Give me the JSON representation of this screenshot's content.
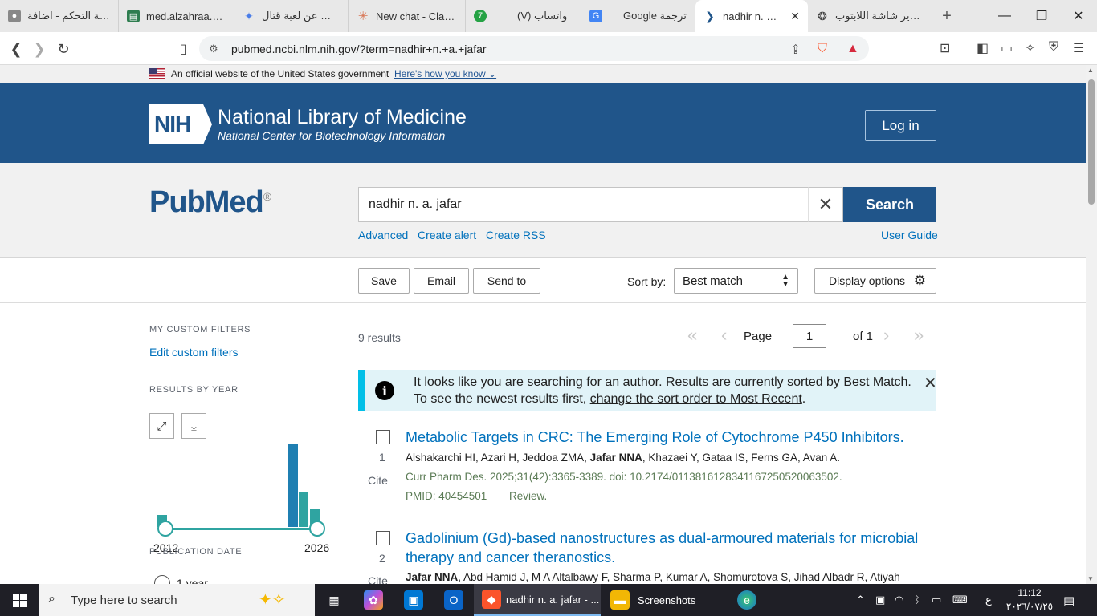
{
  "browser": {
    "tabs": [
      {
        "title": "لوحة التحكم - اضافة",
        "icon": "user-icon"
      },
      {
        "title": "med.alzahraa.edu",
        "icon": "document-icon"
      },
      {
        "title": "البحث عن لعبة قتال",
        "icon": "gemini-icon"
      },
      {
        "title": "New chat - Claude",
        "icon": "claude-icon"
      },
      {
        "title": "(V) واتساب",
        "icon": "whatsapp-icon",
        "badge": "7"
      },
      {
        "title": "Google ترجمة",
        "icon": "translate-icon"
      },
      {
        "title": "nadhir n. a. jafar",
        "icon": "pubmed-icon",
        "active": true
      },
      {
        "title": "تصوير شاشة اللابتوب",
        "icon": "chatgpt-icon"
      }
    ],
    "url": "pubmed.ncbi.nlm.nih.gov/?term=nadhir+n.+a.+jafar"
  },
  "gov_banner": {
    "text": "An official website of the United States government",
    "link": "Here's how you know"
  },
  "header": {
    "logo_text": "NIH",
    "title": "National Library of Medicine",
    "subtitle": "National Center for Biotechnology Information",
    "login": "Log in"
  },
  "search": {
    "logo": "PubMed",
    "logo_mark": "®",
    "query": "nadhir n. a. jafar",
    "button": "Search",
    "links": [
      "Advanced",
      "Create alert",
      "Create RSS"
    ],
    "user_guide": "User Guide"
  },
  "actions": {
    "save": "Save",
    "email": "Email",
    "send_to": "Send to",
    "sort_label": "Sort by:",
    "sort_value": "Best match",
    "display_options": "Display options"
  },
  "sidebar": {
    "custom_filters_heading": "MY CUSTOM FILTERS",
    "edit_custom_filters": "Edit custom filters",
    "results_by_year_heading": "RESULTS BY YEAR",
    "year_start": "2012",
    "year_end": "2026",
    "publication_date_heading": "PUBLICATION DATE",
    "first_option": "1 year"
  },
  "chart_data": {
    "type": "bar",
    "title": "RESULTS BY YEAR",
    "x_range": [
      2012,
      2026
    ],
    "values_relative": [
      {
        "year": 2012,
        "height": 0.14
      },
      {
        "year": 2024,
        "height": 1.0
      },
      {
        "year": 2025,
        "height": 0.41
      },
      {
        "year": 2026,
        "height": 0.21
      }
    ]
  },
  "results": {
    "count": "9 results",
    "page_label": "Page",
    "page": "1",
    "of": "of 1",
    "notice_line1": "It looks like you are searching for an author. Results are currently sorted by Best Match.",
    "notice_line2_prefix": "To see the newest results first,",
    "notice_link": "change the sort order to Most Recent",
    "notice_suffix": ".",
    "cite_label": "Cite",
    "items": [
      {
        "num": "1",
        "title": "Metabolic Targets in CRC: The Emerging Role of Cytochrome P450 Inhibitors.",
        "authors_before": "Alshakarchi HI, Azari H, Jeddoa ZMA,",
        "authors_bold": "Jafar NNA",
        "authors_after": ", Khazaei Y, Gataa IS, Ferns GA, Avan A.",
        "citation": "Curr Pharm Des. 2025;31(42):3365-3389. doi: 10.2174/0113816128341167250520063502.",
        "pmid": "PMID: 40454501",
        "type": "Review."
      },
      {
        "num": "2",
        "title": "Gadolinium (Gd)-based nanostructures as dual-armoured materials for microbial therapy and cancer theranostics.",
        "authors_bold": "Jafar NNA",
        "authors_after": ", Abd Hamid J, M A Altalbawy F, Sharma P, Kumar A, Shomurotova S, Jihad Albadr R, Atiyah"
      }
    ]
  },
  "taskbar": {
    "search_placeholder": "Type here to search",
    "apps": [
      {
        "label": "nadhir n. a. jafar - ...",
        "icon": "brave-icon"
      },
      {
        "label": "Screenshots",
        "icon": "folder-icon"
      }
    ],
    "lang": "ع",
    "time": "11:12",
    "date": "٢٠٢٦/٠٧/٢٥"
  }
}
